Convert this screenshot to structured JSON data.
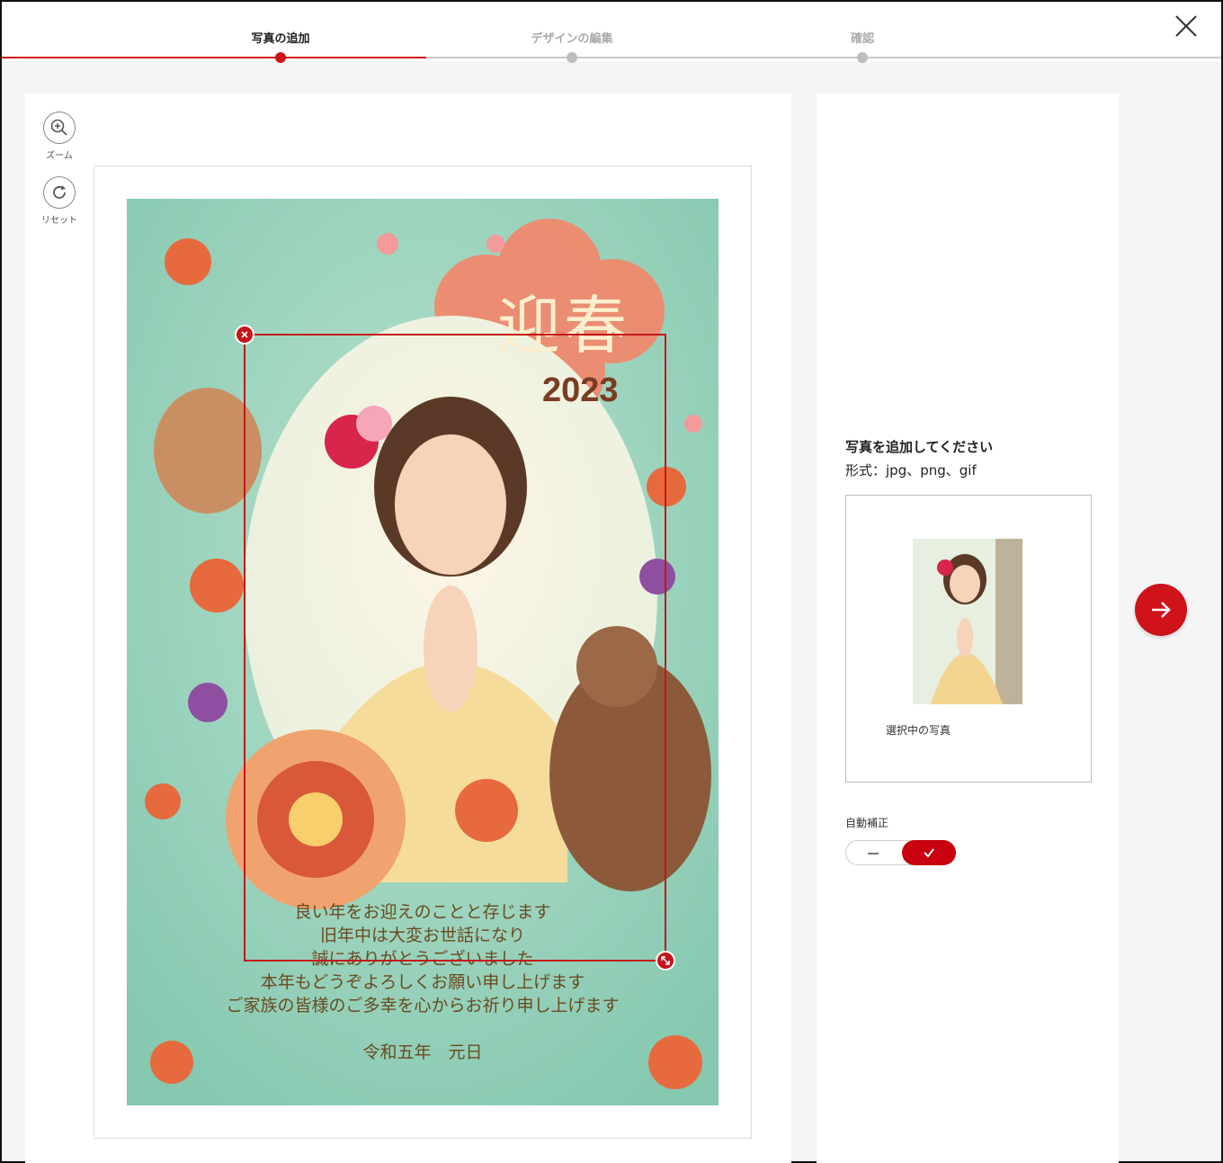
{
  "stepper": {
    "steps": [
      {
        "label": "写真の追加",
        "state": "active"
      },
      {
        "label": "デザインの編集",
        "state": "inactive"
      },
      {
        "label": "確認",
        "state": "inactive"
      }
    ]
  },
  "toolbar": {
    "zoom_label": "ズーム",
    "reset_label": "リセット"
  },
  "card": {
    "title": "迎春",
    "year": "2023",
    "greeting_lines": [
      "良い年をお迎えのことと存じます",
      "旧年中は大変お世話になり",
      "誠にありがとうございました",
      "本年もどうぞよろしくお願い申し上げます",
      "ご家族の皆様のご多幸を心からお祈り申し上げます"
    ],
    "date": "令和五年　元日"
  },
  "side": {
    "title": "写真を追加してください",
    "format": "形式：jpg、png、gif",
    "thumb_caption": "選択中の写真",
    "auto_correct_label": "自動補正"
  },
  "colors": {
    "accent": "#d0121b",
    "card_bg": "#8fcfb7"
  },
  "icons": [
    "close-icon",
    "zoom-in-icon",
    "reset-icon",
    "remove-icon",
    "resize-icon",
    "check-icon",
    "arrow-right-icon"
  ]
}
